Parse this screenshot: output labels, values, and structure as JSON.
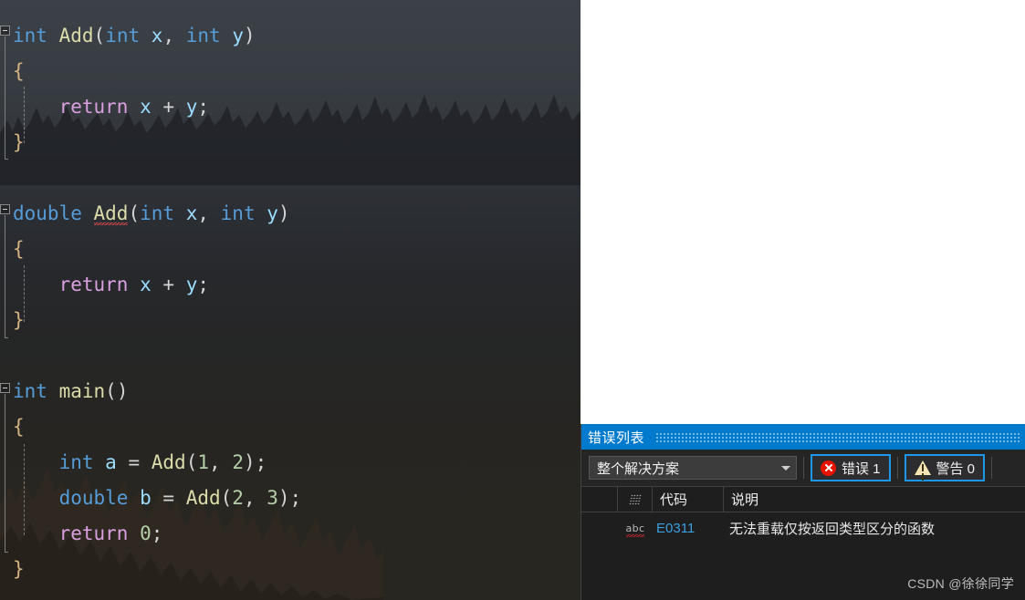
{
  "editor": {
    "language": "cpp",
    "lines": [
      [
        {
          "t": "int",
          "c": "kw"
        },
        {
          "t": " ",
          "c": "punc"
        },
        {
          "t": "Add",
          "c": "fn"
        },
        {
          "t": "(",
          "c": "punc"
        },
        {
          "t": "int",
          "c": "kw"
        },
        {
          "t": " ",
          "c": "punc"
        },
        {
          "t": "x",
          "c": "id"
        },
        {
          "t": ", ",
          "c": "punc"
        },
        {
          "t": "int",
          "c": "kw"
        },
        {
          "t": " ",
          "c": "punc"
        },
        {
          "t": "y",
          "c": "id"
        },
        {
          "t": ")",
          "c": "punc"
        }
      ],
      [
        {
          "t": "{",
          "c": "brc"
        }
      ],
      [
        {
          "t": "    ",
          "c": "punc"
        },
        {
          "t": "return",
          "c": "ctl"
        },
        {
          "t": " ",
          "c": "punc"
        },
        {
          "t": "x",
          "c": "id"
        },
        {
          "t": " + ",
          "c": "punc"
        },
        {
          "t": "y",
          "c": "id"
        },
        {
          "t": ";",
          "c": "punc"
        }
      ],
      [
        {
          "t": "}",
          "c": "brc"
        }
      ],
      [],
      [
        {
          "t": "double",
          "c": "kw"
        },
        {
          "t": " ",
          "c": "punc"
        },
        {
          "t": "Add",
          "c": "fn squiggle"
        },
        {
          "t": "(",
          "c": "punc"
        },
        {
          "t": "int",
          "c": "kw"
        },
        {
          "t": " ",
          "c": "punc"
        },
        {
          "t": "x",
          "c": "id"
        },
        {
          "t": ", ",
          "c": "punc"
        },
        {
          "t": "int",
          "c": "kw"
        },
        {
          "t": " ",
          "c": "punc"
        },
        {
          "t": "y",
          "c": "id"
        },
        {
          "t": ")",
          "c": "punc"
        }
      ],
      [
        {
          "t": "{",
          "c": "brc"
        }
      ],
      [
        {
          "t": "    ",
          "c": "punc"
        },
        {
          "t": "return",
          "c": "ctl"
        },
        {
          "t": " ",
          "c": "punc"
        },
        {
          "t": "x",
          "c": "id"
        },
        {
          "t": " + ",
          "c": "punc"
        },
        {
          "t": "y",
          "c": "id"
        },
        {
          "t": ";",
          "c": "punc"
        }
      ],
      [
        {
          "t": "}",
          "c": "brc"
        }
      ],
      [],
      [
        {
          "t": "int",
          "c": "kw"
        },
        {
          "t": " ",
          "c": "punc"
        },
        {
          "t": "main",
          "c": "fn"
        },
        {
          "t": "()",
          "c": "punc"
        }
      ],
      [
        {
          "t": "{",
          "c": "brc"
        }
      ],
      [
        {
          "t": "    ",
          "c": "punc"
        },
        {
          "t": "int",
          "c": "kw"
        },
        {
          "t": " ",
          "c": "punc"
        },
        {
          "t": "a",
          "c": "id"
        },
        {
          "t": " = ",
          "c": "punc"
        },
        {
          "t": "Add",
          "c": "fn"
        },
        {
          "t": "(",
          "c": "punc"
        },
        {
          "t": "1",
          "c": "num"
        },
        {
          "t": ", ",
          "c": "punc"
        },
        {
          "t": "2",
          "c": "num"
        },
        {
          "t": ");",
          "c": "punc"
        }
      ],
      [
        {
          "t": "    ",
          "c": "punc"
        },
        {
          "t": "double",
          "c": "kw"
        },
        {
          "t": " ",
          "c": "punc"
        },
        {
          "t": "b",
          "c": "id"
        },
        {
          "t": " = ",
          "c": "punc"
        },
        {
          "t": "Add",
          "c": "fn"
        },
        {
          "t": "(",
          "c": "punc"
        },
        {
          "t": "2",
          "c": "num"
        },
        {
          "t": ", ",
          "c": "punc"
        },
        {
          "t": "3",
          "c": "num"
        },
        {
          "t": ");",
          "c": "punc"
        }
      ],
      [
        {
          "t": "    ",
          "c": "punc"
        },
        {
          "t": "return",
          "c": "ctl"
        },
        {
          "t": " ",
          "c": "punc"
        },
        {
          "t": "0",
          "c": "num"
        },
        {
          "t": ";",
          "c": "punc"
        }
      ],
      [
        {
          "t": "}",
          "c": "brc"
        }
      ]
    ],
    "colors": {
      "keyword": "#569cd6",
      "function": "#dcdcaa",
      "number": "#b5cea8",
      "identifier": "#9cdcfe",
      "control": "#d8a0df",
      "brace": "#d4b483",
      "punctuation": "#d4d4d4",
      "squiggle": "#e04a4a"
    }
  },
  "error_list": {
    "title": "错误列表",
    "scope_filter": {
      "value": "整个解决方案",
      "caret_icon": "chevron-down-icon"
    },
    "errors_button": {
      "label": "错误 1",
      "icon": "error-circle-icon",
      "icon_color": "#e51400",
      "active": true
    },
    "warnings_button": {
      "label": "警告 0",
      "icon": "warning-triangle-icon",
      "icon_color": "#f6e6b4",
      "active": true
    },
    "columns": [
      "",
      "",
      "代码",
      "说明"
    ],
    "column_icon": "grid-glyph-icon",
    "rows": [
      {
        "icon": "abc-squiggle-icon",
        "code": "E0311",
        "description": "无法重载仅按返回类型区分的函数"
      }
    ],
    "accent_color": "#007acc",
    "selection_border": "#1c97ea"
  },
  "watermark": {
    "text": "CSDN @徐徐同学"
  }
}
